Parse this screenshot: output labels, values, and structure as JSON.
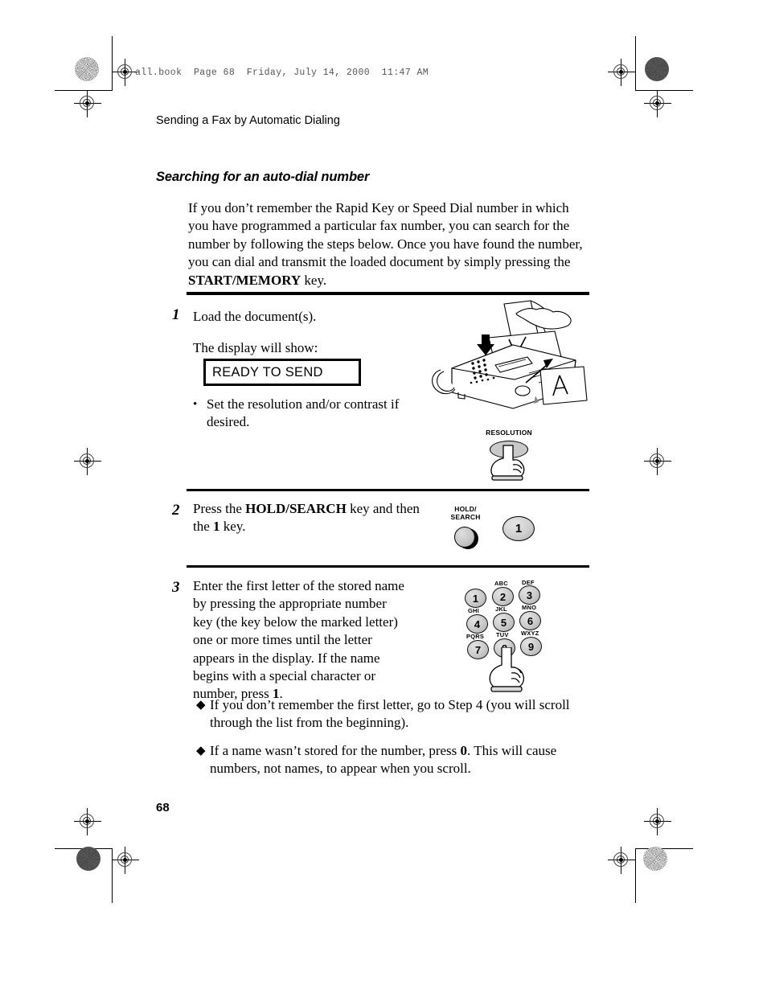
{
  "print_marks": {
    "slug_text": "all.book  Page 68  Friday, July 14, 2000  11:47 AM"
  },
  "running_head": "Sending a Fax by Automatic Dialing",
  "section": {
    "heading": "Searching for an auto-dial number",
    "intro_before_bold": "If you don’t remember the Rapid Key or Speed Dial number in which you have programmed a particular fax number, you can search for the number by following the steps below. Once you have found the number, you can dial and transmit the loaded document by simply pressing the ",
    "intro_bold": "START/MEMORY",
    "intro_after_bold": " key."
  },
  "steps": [
    {
      "number": "1",
      "line1": "Load the document(s).",
      "line2": "The display will show:",
      "lcd_text": "READY TO SEND",
      "bullet": "Set the resolution and/or contrast if desired.",
      "art_label": "RESOLUTION"
    },
    {
      "number": "2",
      "text_part1": "Press the ",
      "text_bold1": "HOLD/SEARCH",
      "text_part2": " key and then the ",
      "text_bold2": "1",
      "text_part3": " key.",
      "art_label": "HOLD/\nSEARCH",
      "art_key": "1"
    },
    {
      "number": "3",
      "text_part1": "Enter the first letter of the stored name by pressing the appropriate number key (the key below the marked letter) one or more times until the letter appears in the display. If the name begins with a special character or number, press ",
      "text_bold1": "1",
      "text_part2": "."
    }
  ],
  "keypad": [
    {
      "digit": "1",
      "letters": ""
    },
    {
      "digit": "2",
      "letters": "ABC"
    },
    {
      "digit": "3",
      "letters": "DEF"
    },
    {
      "digit": "4",
      "letters": "GHI"
    },
    {
      "digit": "5",
      "letters": "JKL"
    },
    {
      "digit": "6",
      "letters": "MNO"
    },
    {
      "digit": "7",
      "letters": "PQRS"
    },
    {
      "digit": "8",
      "letters": "TUV"
    },
    {
      "digit": "9",
      "letters": "WXYZ"
    }
  ],
  "notes": [
    {
      "marker": "♦",
      "part1": "If you don’t remember the first letter, go to Step 4 (you will scroll through the list from the beginning).",
      "bold": "",
      "part2": ""
    },
    {
      "marker": "♦",
      "part1": "If a name wasn’t stored for the number, press ",
      "bold": "0",
      "part2": ". This will cause numbers, not names, to appear when you scroll."
    }
  ],
  "folio": "68",
  "colors": {
    "ink": "#000000",
    "paper": "#ffffff",
    "key_face": "#c9c9c9",
    "slug": "#555555"
  }
}
